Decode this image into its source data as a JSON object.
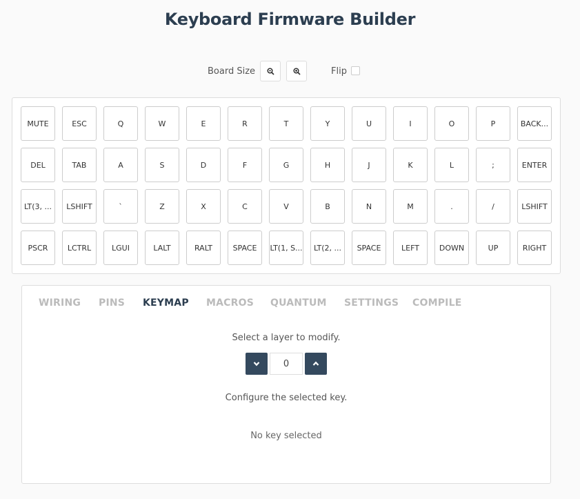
{
  "app": {
    "title": "Keyboard Firmware Builder"
  },
  "board": {
    "size_label": "Board Size",
    "zoom_out_icon": "zoom-out-icon",
    "zoom_in_icon": "zoom-in-icon",
    "flip_label": "Flip",
    "flip_checked": false
  },
  "keyboard": {
    "rows": [
      [
        "MUTE",
        "ESC",
        "Q",
        "W",
        "E",
        "R",
        "T",
        "Y",
        "U",
        "I",
        "O",
        "P",
        "BACK..."
      ],
      [
        "DEL",
        "TAB",
        "A",
        "S",
        "D",
        "F",
        "G",
        "H",
        "J",
        "K",
        "L",
        ";",
        "ENTER"
      ],
      [
        "LT(3, ...",
        "LSHIFT",
        "`",
        "Z",
        "X",
        "C",
        "V",
        "B",
        "N",
        "M",
        ".",
        "/",
        "LSHIFT"
      ],
      [
        "PSCR",
        "LCTRL",
        "LGUI",
        "LALT",
        "RALT",
        "SPACE",
        "LT(1, S...",
        "LT(2, ...",
        "SPACE",
        "LEFT",
        "DOWN",
        "UP",
        "RIGHT"
      ]
    ]
  },
  "tabs": [
    {
      "label": "WIRING",
      "active": false
    },
    {
      "label": "PINS",
      "active": false
    },
    {
      "label": "KEYMAP",
      "active": true
    },
    {
      "label": "MACROS",
      "active": false
    },
    {
      "label": "QUANTUM",
      "active": false
    },
    {
      "label": "SETTINGS",
      "active": false
    },
    {
      "label": "COMPILE",
      "active": false
    }
  ],
  "keymap": {
    "select_layer_label": "Select a layer to modify.",
    "layer_value": "0",
    "layer_down_icon": "chevron-down-icon",
    "layer_up_icon": "chevron-up-icon",
    "configure_label": "Configure the selected key.",
    "no_key_text": "No key selected"
  },
  "colors": {
    "accent": "#34495e",
    "title": "#2c3e50",
    "tab_inactive": "#bbbbbb"
  }
}
